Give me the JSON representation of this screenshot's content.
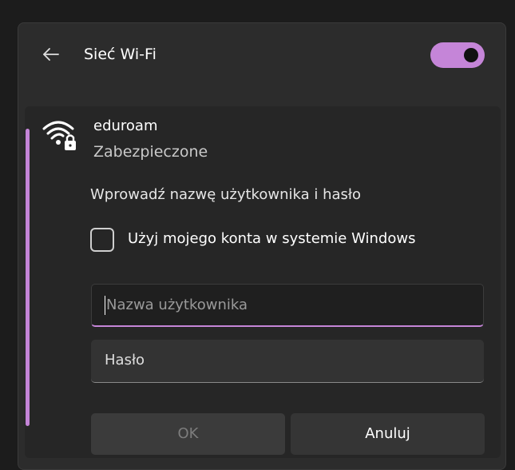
{
  "header": {
    "title": "Sieć Wi-Fi",
    "back_icon": "arrow-left-icon",
    "wifi_toggle_on": true
  },
  "network": {
    "name": "eduroam",
    "status": "Zabezpieczone",
    "icon": "wifi-secured-icon"
  },
  "form": {
    "prompt": "Wprowadź nazwę użytkownika i hasło",
    "use_windows_account_label": "Użyj mojego konta w systemie Windows",
    "use_windows_account_checked": false,
    "username_placeholder": "Nazwa użytkownika",
    "username_value": "",
    "password_placeholder": "Hasło",
    "password_value": ""
  },
  "buttons": {
    "ok_label": "OK",
    "cancel_label": "Anuluj"
  },
  "colors": {
    "accent": "#c585d8",
    "background": "#2c2c2c"
  }
}
